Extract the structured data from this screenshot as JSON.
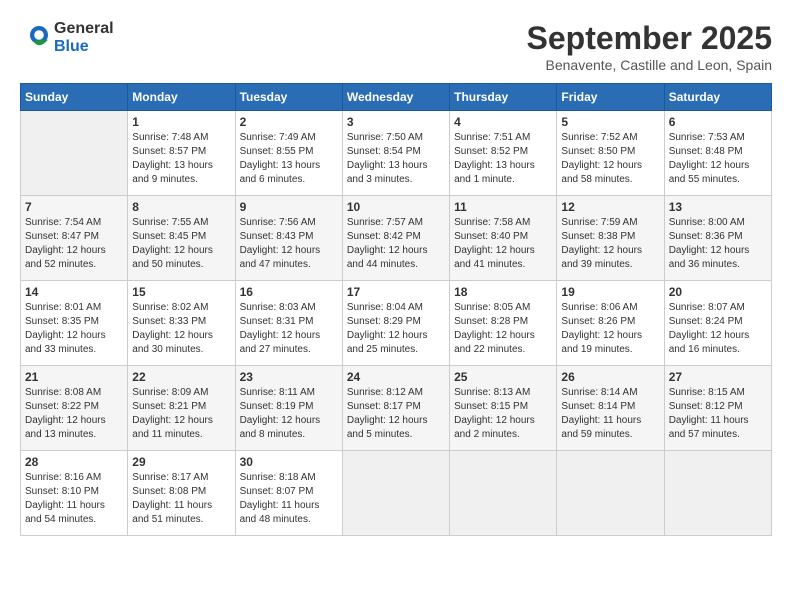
{
  "header": {
    "logo_general": "General",
    "logo_blue": "Blue",
    "title": "September 2025",
    "subtitle": "Benavente, Castille and Leon, Spain"
  },
  "calendar": {
    "headers": [
      "Sunday",
      "Monday",
      "Tuesday",
      "Wednesday",
      "Thursday",
      "Friday",
      "Saturday"
    ],
    "weeks": [
      [
        {
          "day": "",
          "info": ""
        },
        {
          "day": "1",
          "info": "Sunrise: 7:48 AM\nSunset: 8:57 PM\nDaylight: 13 hours\nand 9 minutes."
        },
        {
          "day": "2",
          "info": "Sunrise: 7:49 AM\nSunset: 8:55 PM\nDaylight: 13 hours\nand 6 minutes."
        },
        {
          "day": "3",
          "info": "Sunrise: 7:50 AM\nSunset: 8:54 PM\nDaylight: 13 hours\nand 3 minutes."
        },
        {
          "day": "4",
          "info": "Sunrise: 7:51 AM\nSunset: 8:52 PM\nDaylight: 13 hours\nand 1 minute."
        },
        {
          "day": "5",
          "info": "Sunrise: 7:52 AM\nSunset: 8:50 PM\nDaylight: 12 hours\nand 58 minutes."
        },
        {
          "day": "6",
          "info": "Sunrise: 7:53 AM\nSunset: 8:48 PM\nDaylight: 12 hours\nand 55 minutes."
        }
      ],
      [
        {
          "day": "7",
          "info": "Sunrise: 7:54 AM\nSunset: 8:47 PM\nDaylight: 12 hours\nand 52 minutes."
        },
        {
          "day": "8",
          "info": "Sunrise: 7:55 AM\nSunset: 8:45 PM\nDaylight: 12 hours\nand 50 minutes."
        },
        {
          "day": "9",
          "info": "Sunrise: 7:56 AM\nSunset: 8:43 PM\nDaylight: 12 hours\nand 47 minutes."
        },
        {
          "day": "10",
          "info": "Sunrise: 7:57 AM\nSunset: 8:42 PM\nDaylight: 12 hours\nand 44 minutes."
        },
        {
          "day": "11",
          "info": "Sunrise: 7:58 AM\nSunset: 8:40 PM\nDaylight: 12 hours\nand 41 minutes."
        },
        {
          "day": "12",
          "info": "Sunrise: 7:59 AM\nSunset: 8:38 PM\nDaylight: 12 hours\nand 39 minutes."
        },
        {
          "day": "13",
          "info": "Sunrise: 8:00 AM\nSunset: 8:36 PM\nDaylight: 12 hours\nand 36 minutes."
        }
      ],
      [
        {
          "day": "14",
          "info": "Sunrise: 8:01 AM\nSunset: 8:35 PM\nDaylight: 12 hours\nand 33 minutes."
        },
        {
          "day": "15",
          "info": "Sunrise: 8:02 AM\nSunset: 8:33 PM\nDaylight: 12 hours\nand 30 minutes."
        },
        {
          "day": "16",
          "info": "Sunrise: 8:03 AM\nSunset: 8:31 PM\nDaylight: 12 hours\nand 27 minutes."
        },
        {
          "day": "17",
          "info": "Sunrise: 8:04 AM\nSunset: 8:29 PM\nDaylight: 12 hours\nand 25 minutes."
        },
        {
          "day": "18",
          "info": "Sunrise: 8:05 AM\nSunset: 8:28 PM\nDaylight: 12 hours\nand 22 minutes."
        },
        {
          "day": "19",
          "info": "Sunrise: 8:06 AM\nSunset: 8:26 PM\nDaylight: 12 hours\nand 19 minutes."
        },
        {
          "day": "20",
          "info": "Sunrise: 8:07 AM\nSunset: 8:24 PM\nDaylight: 12 hours\nand 16 minutes."
        }
      ],
      [
        {
          "day": "21",
          "info": "Sunrise: 8:08 AM\nSunset: 8:22 PM\nDaylight: 12 hours\nand 13 minutes."
        },
        {
          "day": "22",
          "info": "Sunrise: 8:09 AM\nSunset: 8:21 PM\nDaylight: 12 hours\nand 11 minutes."
        },
        {
          "day": "23",
          "info": "Sunrise: 8:11 AM\nSunset: 8:19 PM\nDaylight: 12 hours\nand 8 minutes."
        },
        {
          "day": "24",
          "info": "Sunrise: 8:12 AM\nSunset: 8:17 PM\nDaylight: 12 hours\nand 5 minutes."
        },
        {
          "day": "25",
          "info": "Sunrise: 8:13 AM\nSunset: 8:15 PM\nDaylight: 12 hours\nand 2 minutes."
        },
        {
          "day": "26",
          "info": "Sunrise: 8:14 AM\nSunset: 8:14 PM\nDaylight: 11 hours\nand 59 minutes."
        },
        {
          "day": "27",
          "info": "Sunrise: 8:15 AM\nSunset: 8:12 PM\nDaylight: 11 hours\nand 57 minutes."
        }
      ],
      [
        {
          "day": "28",
          "info": "Sunrise: 8:16 AM\nSunset: 8:10 PM\nDaylight: 11 hours\nand 54 minutes."
        },
        {
          "day": "29",
          "info": "Sunrise: 8:17 AM\nSunset: 8:08 PM\nDaylight: 11 hours\nand 51 minutes."
        },
        {
          "day": "30",
          "info": "Sunrise: 8:18 AM\nSunset: 8:07 PM\nDaylight: 11 hours\nand 48 minutes."
        },
        {
          "day": "",
          "info": ""
        },
        {
          "day": "",
          "info": ""
        },
        {
          "day": "",
          "info": ""
        },
        {
          "day": "",
          "info": ""
        }
      ]
    ]
  }
}
